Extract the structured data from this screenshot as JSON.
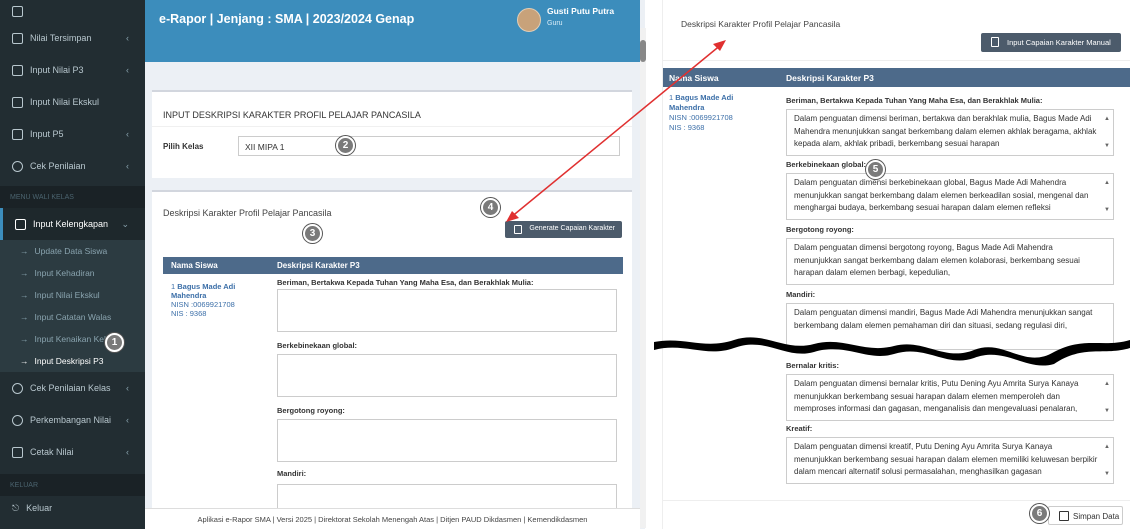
{
  "sidebar": {
    "items_top": [
      {
        "label": "Nilai Tersimpan",
        "icon": "save-icon"
      },
      {
        "label": "Input Nilai P3",
        "icon": "edit-icon"
      },
      {
        "label": "Input Nilai Ekskul",
        "icon": "edit-icon"
      },
      {
        "label": "Input P5",
        "icon": "edit-icon"
      },
      {
        "label": "Cek Penilaian",
        "icon": "graduation-cap-icon"
      }
    ],
    "section_wali": "MENU WALI KELAS",
    "active_group": "Input Kelengkapan",
    "sub_items": [
      "Update Data Siswa",
      "Input Kehadiran",
      "Input Nilai Ekskul",
      "Input Catatan Walas",
      "Input Kenaikan Kelas",
      "Input Deskripsi P3"
    ],
    "items_bottom": [
      {
        "label": "Cek Penilaian Kelas",
        "icon": "graduation-cap-icon"
      },
      {
        "label": "Perkembangan Nilai",
        "icon": "graduation-cap-icon"
      },
      {
        "label": "Cetak Nilai",
        "icon": "print-icon"
      }
    ],
    "section_keluar": "KELUAR",
    "logout": "Keluar"
  },
  "topbar": {
    "brand": "e-Rapor | Jenjang : SMA | 2023/2024 Genap",
    "user_name": "Gusti Putu Putra",
    "user_role": "Guru"
  },
  "form": {
    "title": "INPUT DESKRIPSI KARAKTER PROFIL PELAJAR PANCASILA",
    "kelas_label": "Pilih Kelas",
    "kelas_value": "XII MIPA 1"
  },
  "desc_box": {
    "title": "Deskripsi Karakter Profil Pelajar Pancasila",
    "generate_button": "Generate Capaian Karakter",
    "col_name": "Nama Siswa",
    "col_desc": "Deskripsi Karakter P3"
  },
  "student": {
    "number": "1",
    "name": "Bagus Made Adi Mahendra",
    "nisn": "NISN :0069921708",
    "nis": "NIS : 9368"
  },
  "dimensions": [
    "Beriman, Bertakwa Kepada Tuhan Yang Maha Esa, dan Berakhlak Mulia:",
    "Berkebinekaan global:",
    "Bergotong royong:",
    "Mandiri:",
    "Bernalar kritis:",
    "Kreatif:"
  ],
  "descriptions": [
    "Dalam penguatan dimensi beriman, bertakwa dan berakhlak mulia, Bagus Made Adi Mahendra menunjukkan  sangat berkembang dalam elemen akhlak beragama, akhlak kepada alam, akhlak pribadi,  berkembang sesuai harapan",
    "Dalam penguatan dimensi berkebinekaan global, Bagus Made Adi Mahendra menunjukkan  sangat berkembang dalam elemen berkeadilan sosial, mengenal dan menghargai budaya,  berkembang sesuai harapan dalam elemen refleksi",
    "Dalam penguatan dimensi bergotong royong, Bagus Made Adi Mahendra menunjukkan  sangat berkembang dalam elemen kolaborasi,  berkembang sesuai harapan dalam elemen berbagi, kepedulian,",
    "Dalam penguatan dimensi mandiri, Bagus Made Adi Mahendra menunjukkan sangat berkembang dalam elemen pemahaman diri dan situasi,  sedang regulasi diri,",
    "Dalam penguatan dimensi bernalar kritis, Putu Dening Ayu Amrita Surya Kanaya menunjukkan  berkembang sesuai harapan dalam elemen memperoleh dan memproses informasi dan gagasan, menganalisis dan mengevaluasi penalaran,",
    "Dalam penguatan dimensi kreatif, Putu Dening Ayu Amrita Surya Kanaya menunjukkan  berkembang sesuai harapan dalam elemen memiliki keluwesan berpikir dalam mencari alternatif solusi permasalahan, menghasilkan gagasan"
  ],
  "zoom_panel": {
    "manual_button": "Input Capaian Karakter Manual",
    "save_button": "Simpan Data"
  },
  "footer": "Aplikasi e-Rapor SMA | Versi 2025 | Direktorat Sekolah Menengah Atas | Ditjen PAUD Dikdasmen | Kemendikdasmen",
  "markers": [
    "1",
    "2",
    "3",
    "4",
    "5",
    "6"
  ],
  "colors": {
    "sidebar": "#222d32",
    "header": "#3c8dbc",
    "table_head": "#4d6a8a",
    "arrow": "#e03030"
  }
}
